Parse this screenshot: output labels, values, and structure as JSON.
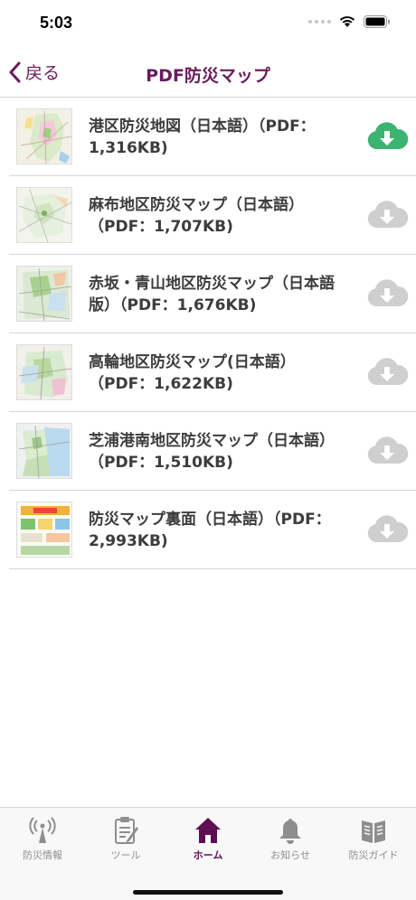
{
  "status": {
    "time": "5:03"
  },
  "nav": {
    "back_label": "戻る",
    "title": "PDF防災マップ"
  },
  "colors": {
    "accent": "#6b1a5e",
    "download_active": "#3cb371",
    "download_inactive": "#cfcfcf"
  },
  "items": [
    {
      "title": "港区防災地図（日本語）（PDF：1,316KB)",
      "downloaded": true,
      "thumb": "map-thumbnail"
    },
    {
      "title": "麻布地区防災マップ（日本語）（PDF：1,707KB)",
      "downloaded": false,
      "thumb": "map-thumbnail"
    },
    {
      "title": "赤坂・青山地区防災マップ（日本語版）（PDF：1,676KB)",
      "downloaded": false,
      "thumb": "map-thumbnail"
    },
    {
      "title": "高輪地区防災マップ(日本語）（PDF：1,622KB)",
      "downloaded": false,
      "thumb": "map-thumbnail"
    },
    {
      "title": "芝浦港南地区防災マップ（日本語）（PDF：1,510KB)",
      "downloaded": false,
      "thumb": "map-thumbnail"
    },
    {
      "title": "防災マップ裏面（日本語）（PDF：2,993KB)",
      "downloaded": false,
      "thumb": "brochure-thumbnail"
    }
  ],
  "tabs": [
    {
      "label": "防災情報",
      "icon": "antenna-icon",
      "active": false
    },
    {
      "label": "ツール",
      "icon": "clipboard-icon",
      "active": false
    },
    {
      "label": "ホーム",
      "icon": "home-icon",
      "active": true
    },
    {
      "label": "お知らせ",
      "icon": "bell-icon",
      "active": false
    },
    {
      "label": "防災ガイド",
      "icon": "guide-book-icon",
      "active": false
    }
  ]
}
